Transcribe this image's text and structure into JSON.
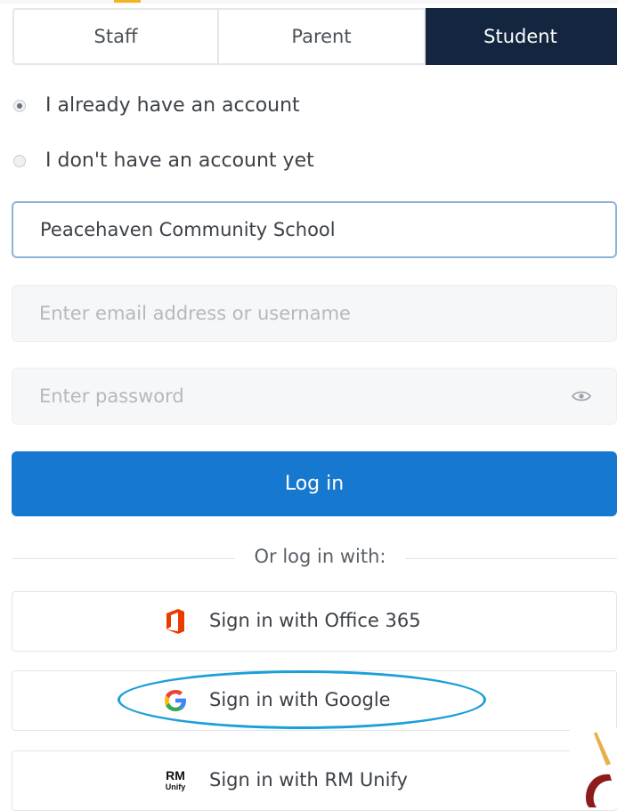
{
  "tabs": {
    "staff": "Staff",
    "parent": "Parent",
    "student": "Student"
  },
  "account_options": {
    "existing": "I already have an account",
    "new": "I don't have an account yet"
  },
  "form": {
    "school_value": "Peacehaven Community School",
    "email_placeholder": "Enter email address or username",
    "password_placeholder": "Enter password",
    "login_label": "Log in"
  },
  "divider": {
    "text": "Or log in with:"
  },
  "sso": {
    "office_label": "Sign in with Office 365",
    "google_label": "Sign in with Google",
    "rm_label": "Sign in with RM Unify",
    "rm_logo_top": "RM",
    "rm_logo_bottom": "Unify"
  },
  "colors": {
    "active_tab": "#14263f",
    "login_button": "#1679cf",
    "school_border": "#8fb2dc",
    "highlight_ellipse": "#1b9fd8",
    "office_orange": "#eb3c00"
  },
  "icons": {
    "eye": "eye-icon",
    "office": "office-365-icon",
    "google": "google-icon",
    "rm": "rm-unify-icon"
  }
}
